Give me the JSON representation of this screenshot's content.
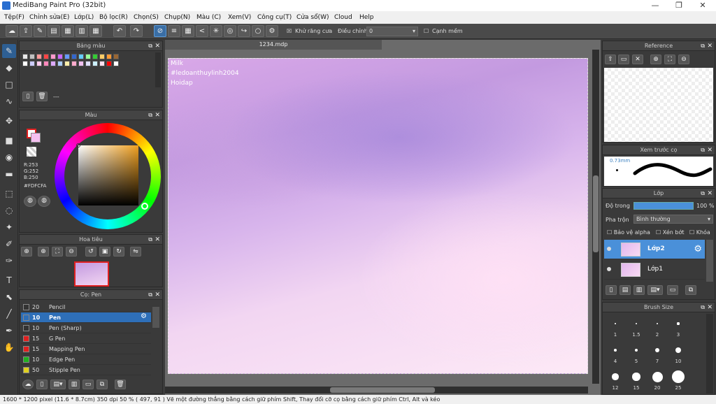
{
  "window": {
    "title": "MediBang Paint Pro (32bit)",
    "min": "—",
    "max": "❐",
    "close": "✕"
  },
  "menu": [
    "Tệp(F)",
    "Chỉnh sửa(E)",
    "Lớp(L)",
    "Bộ lọc(R)",
    "Chọn(S)",
    "Chụp(N)",
    "Màu (C)",
    "Xem(V)",
    "Công cụ(T)",
    "Cửa sổ(W)",
    "Cloud",
    "Help"
  ],
  "toolbar": {
    "antialias_label": "Khử răng cưa",
    "adjust_label": "Điều chỉnh",
    "adjust_value": "0",
    "snap_label": "Cạnh mềm"
  },
  "panels": {
    "palette": "Bảng màu",
    "palette_dash": "---",
    "color": "Màu",
    "color_rgb": {
      "r": "R:253",
      "g": "G:252",
      "b": "B:250"
    },
    "color_hex": "#FDFCFA",
    "navigator": "Hoa tiêu",
    "brush": "Cọ: Pen",
    "reference": "Reference",
    "preview": "Xem trước cọ",
    "preview_size": "0.73mm",
    "layer": "Lớp",
    "opacity_label": "Độ trong",
    "opacity_value": "100 %",
    "blend_label": "Pha trộn",
    "blend_value": "Bình thường",
    "protect_alpha": "Bảo vệ alpha",
    "clip": "Xén bớt",
    "lock": "Khóa",
    "brushsize": "Brush Size"
  },
  "brushes": [
    {
      "size": "20",
      "name": "Pencil",
      "color": "#333333"
    },
    {
      "size": "10",
      "name": "Pen",
      "color": "#2e6fb8"
    },
    {
      "size": "10",
      "name": "Pen (Sharp)",
      "color": "#333333"
    },
    {
      "size": "15",
      "name": "G Pen",
      "color": "#e02020"
    },
    {
      "size": "15",
      "name": "Mapping Pen",
      "color": "#e02020"
    },
    {
      "size": "10",
      "name": "Edge Pen",
      "color": "#20b020"
    },
    {
      "size": "50",
      "name": "Stipple Pen",
      "color": "#e0d020"
    }
  ],
  "layers": [
    {
      "name": "Lớp2"
    },
    {
      "name": "Lớp1"
    }
  ],
  "brush_sizes": [
    "1",
    "1.5",
    "2",
    "3",
    "4",
    "5",
    "7",
    "10",
    "12",
    "15",
    "20",
    "25"
  ],
  "canvas": {
    "tab": "1234.mdp",
    "lines": [
      "Milk",
      "#ledoanthuylinh2004",
      "Hoidap"
    ]
  },
  "status": "1600 * 1200 pixel   (11.6 * 8.7cm)   350 dpi   50 %   ( 497, 91 )   Vẽ một đường thẳng bằng cách giữ phím Shift, Thay đổi cỡ cọ bằng cách giữ phím Ctrl, Alt và kéo",
  "swatches": [
    "#e7e7e7",
    "#c0c0c0",
    "#ff9999",
    "#ff4444",
    "#ff99cc",
    "#cc66ff",
    "#6699ff",
    "#3366cc",
    "#66ccff",
    "#99ff99",
    "#33cc33",
    "#ffcc66",
    "#ff9933",
    "#996633",
    "#ffffff",
    "#ccccff",
    "#ffccee",
    "#ff88bb",
    "#ddaaff",
    "#aaccff",
    "#ffeeaa",
    "#ffaacc",
    "#f0c0f0",
    "#e0e0ff",
    "#ccf0ff",
    "#ffe0f0",
    "#ff0000",
    "#ffffff"
  ]
}
